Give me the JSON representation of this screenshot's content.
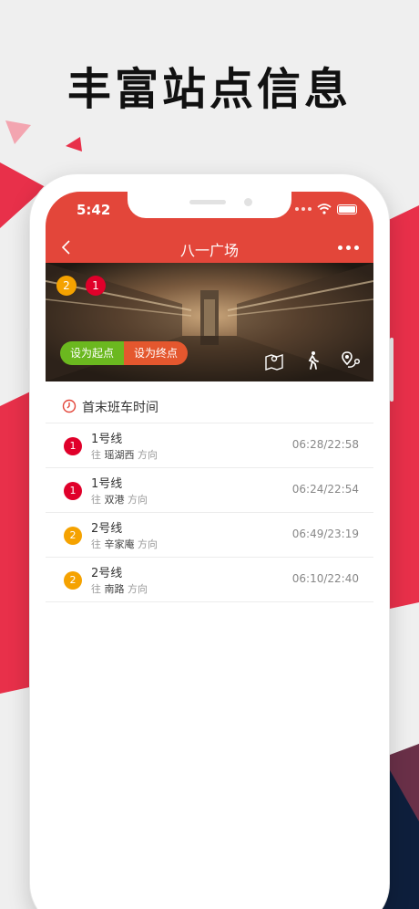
{
  "headline": "丰富站点信息",
  "status_bar": {
    "time": "5:42"
  },
  "nav": {
    "title": "八一广场"
  },
  "station_lines": [
    {
      "number": "2",
      "color": "#f5a200"
    },
    {
      "number": "1",
      "color": "#e0002a"
    }
  ],
  "actions": {
    "set_start": "设为起点",
    "set_end": "设为终点"
  },
  "colors": {
    "accent": "#e3463a",
    "start_green": "#6bb81f",
    "end_orange": "#e4572e"
  },
  "section": {
    "title": "首末班车时间"
  },
  "schedules": [
    {
      "badge": "1",
      "badge_color": "#e0002a",
      "line": "1号线",
      "dir_prefix": "往",
      "destination": "瑶湖西",
      "dir_suffix": "方向",
      "times": "06:28/22:58"
    },
    {
      "badge": "1",
      "badge_color": "#e0002a",
      "line": "1号线",
      "dir_prefix": "往",
      "destination": "双港",
      "dir_suffix": "方向",
      "times": "06:24/22:54"
    },
    {
      "badge": "2",
      "badge_color": "#f5a200",
      "line": "2号线",
      "dir_prefix": "往",
      "destination": "辛家庵",
      "dir_suffix": "方向",
      "times": "06:49/23:19"
    },
    {
      "badge": "2",
      "badge_color": "#f5a200",
      "line": "2号线",
      "dir_prefix": "往",
      "destination": "南路",
      "dir_suffix": "方向",
      "times": "06:10/22:40"
    }
  ]
}
